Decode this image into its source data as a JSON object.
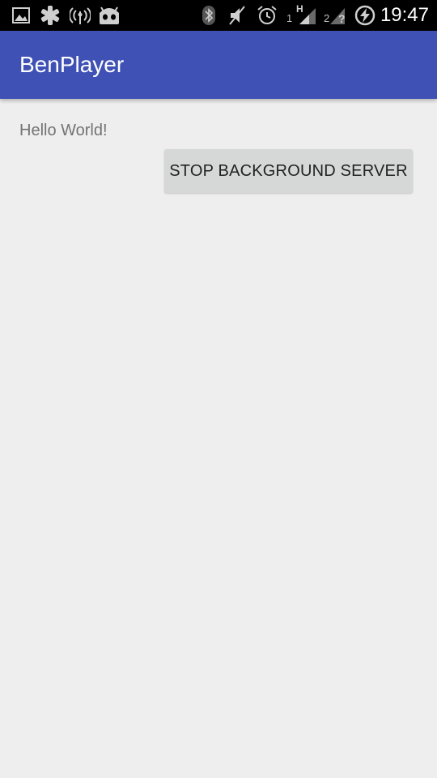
{
  "status_bar": {
    "time": "19:47",
    "left_icons": [
      "image-icon",
      "cyanogen-icon",
      "wireless-icon",
      "android-debug-icon"
    ],
    "right_icons": [
      "bluetooth-icon",
      "mute-icon",
      "alarm-icon",
      "signal-sim1-icon",
      "signal-sim2-icon",
      "battery-charging-icon"
    ],
    "sim1_label": "1",
    "sim1_network": "H",
    "sim2_label": "2"
  },
  "toolbar": {
    "title": "BenPlayer",
    "color": "#3f51b5"
  },
  "content": {
    "hello_text": "Hello World!",
    "stop_button_label": "STOP BACKGROUND SERVER"
  },
  "colors": {
    "background": "#eeeeee",
    "button": "#d6d7d7",
    "status_bar": "#000000"
  }
}
